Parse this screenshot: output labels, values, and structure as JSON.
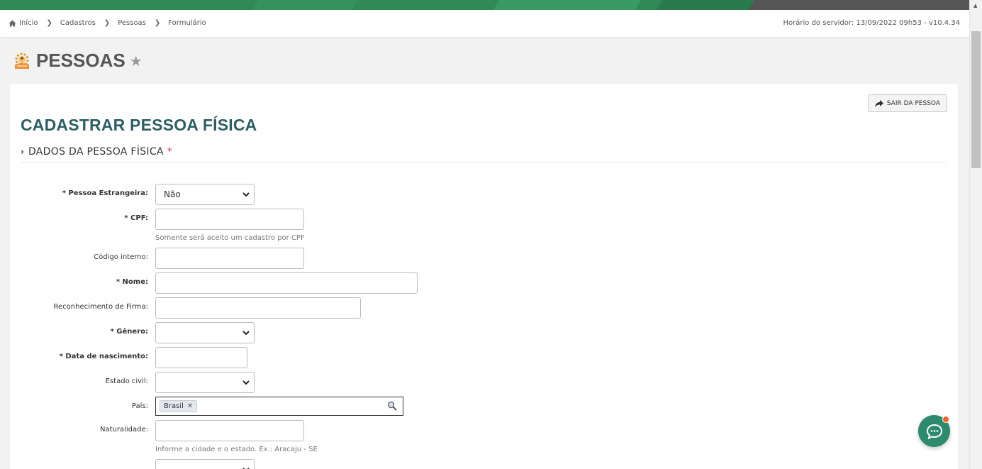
{
  "breadcrumb": {
    "items": [
      "Início",
      "Cadastros",
      "Pessoas",
      "Formulário"
    ]
  },
  "server_time": "Horário do servidor: 13/09/2022 09h53 - v10.4.34",
  "page": {
    "title": "PESSOAS"
  },
  "exit_button": "SAIR DA PESSOA",
  "form": {
    "title": "CADASTRAR PESSOA FÍSICA",
    "section": "DADOS DA PESSOA FÍSICA",
    "section_required": "*",
    "fields": {
      "estrangeira": {
        "label": "* Pessoa Estrangeira:",
        "value": "Não"
      },
      "cpf": {
        "label": "* CPF:",
        "value": "",
        "hint": "Somente será aceito um cadastro por CPF"
      },
      "codigo": {
        "label": "Código interno:",
        "value": ""
      },
      "nome": {
        "label": "* Nome:",
        "value": ""
      },
      "firma": {
        "label": "Reconhecimento de Firma:",
        "value": ""
      },
      "genero": {
        "label": "* Gênero:",
        "value": ""
      },
      "nascimento": {
        "label": "* Data de nascimento:",
        "value": ""
      },
      "estado_civil": {
        "label": "Estado civil:",
        "value": ""
      },
      "pais": {
        "label": "País:",
        "tag": "Brasil"
      },
      "naturalidade": {
        "label": "Naturalidade:",
        "value": "",
        "hint": "Informe a cidade e o estado. Ex.: Aracaju - SE"
      }
    }
  },
  "colors": {
    "accent_green": "#2f8a57",
    "title_teal": "#2e5e63",
    "chat_button": "#2e8a6c",
    "notification_dot": "#f0642a",
    "required_red": "#d9363e"
  },
  "icons": [
    "home-icon",
    "chevron-right-icon",
    "people-gear-icon",
    "star-icon",
    "share-arrow-icon",
    "chevron-down-icon",
    "search-icon",
    "chat-icon"
  ]
}
